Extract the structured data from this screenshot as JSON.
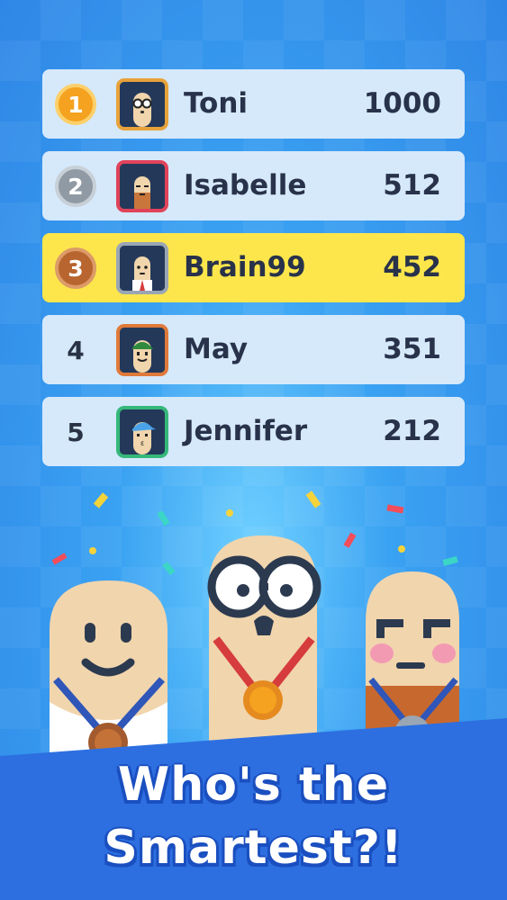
{
  "leaderboard": [
    {
      "rank": "1",
      "name": "Toni",
      "score": "1000",
      "badge": "gold",
      "avatar_border": "#e8a23b",
      "highlight": false
    },
    {
      "rank": "2",
      "name": "Isabelle",
      "score": "512",
      "badge": "silver",
      "avatar_border": "#e0435a",
      "highlight": false
    },
    {
      "rank": "3",
      "name": "Brain99",
      "score": "452",
      "badge": "bronze",
      "avatar_border": "#9aa6b4",
      "highlight": true
    },
    {
      "rank": "4",
      "name": "May",
      "score": "351",
      "badge": "none",
      "avatar_border": "#e07a3a",
      "highlight": false
    },
    {
      "rank": "5",
      "name": "Jennifer",
      "score": "212",
      "badge": "none",
      "avatar_border": "#35b87a",
      "highlight": false
    }
  ],
  "banner": {
    "line1": "Who's the",
    "line2": "Smartest?!"
  },
  "colors": {
    "row_bg": "#d6e9fb",
    "row_highlight": "#fde64b",
    "text_dark": "#28324a",
    "banner_blue": "#2d6fe0"
  },
  "icons": [
    "avatar-glasses-icon",
    "avatar-beard-icon",
    "avatar-tie-icon",
    "avatar-hat-icon",
    "avatar-cap-icon"
  ]
}
